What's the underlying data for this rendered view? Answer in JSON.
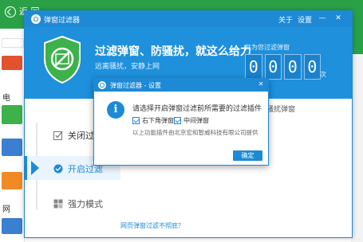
{
  "main_app": {
    "back_label": "返 回",
    "sidebar_text": [
      "电",
      "网"
    ]
  },
  "plugin": {
    "title": "弹窗过滤器",
    "about_label": "关于",
    "settings_label": "设置",
    "minimize_glyph": "—",
    "close_glyph": "✕",
    "banner": {
      "title": "过滤弹窗、防骚扰，就这么给力",
      "subtitle": "远离骚扰，安静上网",
      "counter_label": "共为您过滤弹窗",
      "counter_digits": [
        "0",
        "0",
        "0",
        "0"
      ],
      "counter_unit": "次"
    },
    "steps": [
      {
        "label": "关闭过滤"
      },
      {
        "label": "开启过滤"
      },
      {
        "label": "强力模式"
      }
    ],
    "behind_text": "下角/中间骚扰弹窗",
    "footer_link": "网页弹窗过滤不彻底？"
  },
  "modal": {
    "title": "弹窗过滤器 - 设置",
    "close_glyph": "✕",
    "info_glyph": "i",
    "question": "请选择开启弹窗过滤前所需要的过滤插件",
    "options": [
      {
        "label": "右下角弹窗",
        "checked": true
      },
      {
        "label": "中间弹窗",
        "checked": true
      }
    ],
    "note": "以上功能插件由北京宏和智威科技有限公司提供",
    "confirm_label": "确定"
  },
  "colors": {
    "main_green": "#2aa146",
    "accent_blue": "#1e8ad6",
    "banner_blue": "#1e90dc",
    "shield_green": "#3db24a"
  }
}
